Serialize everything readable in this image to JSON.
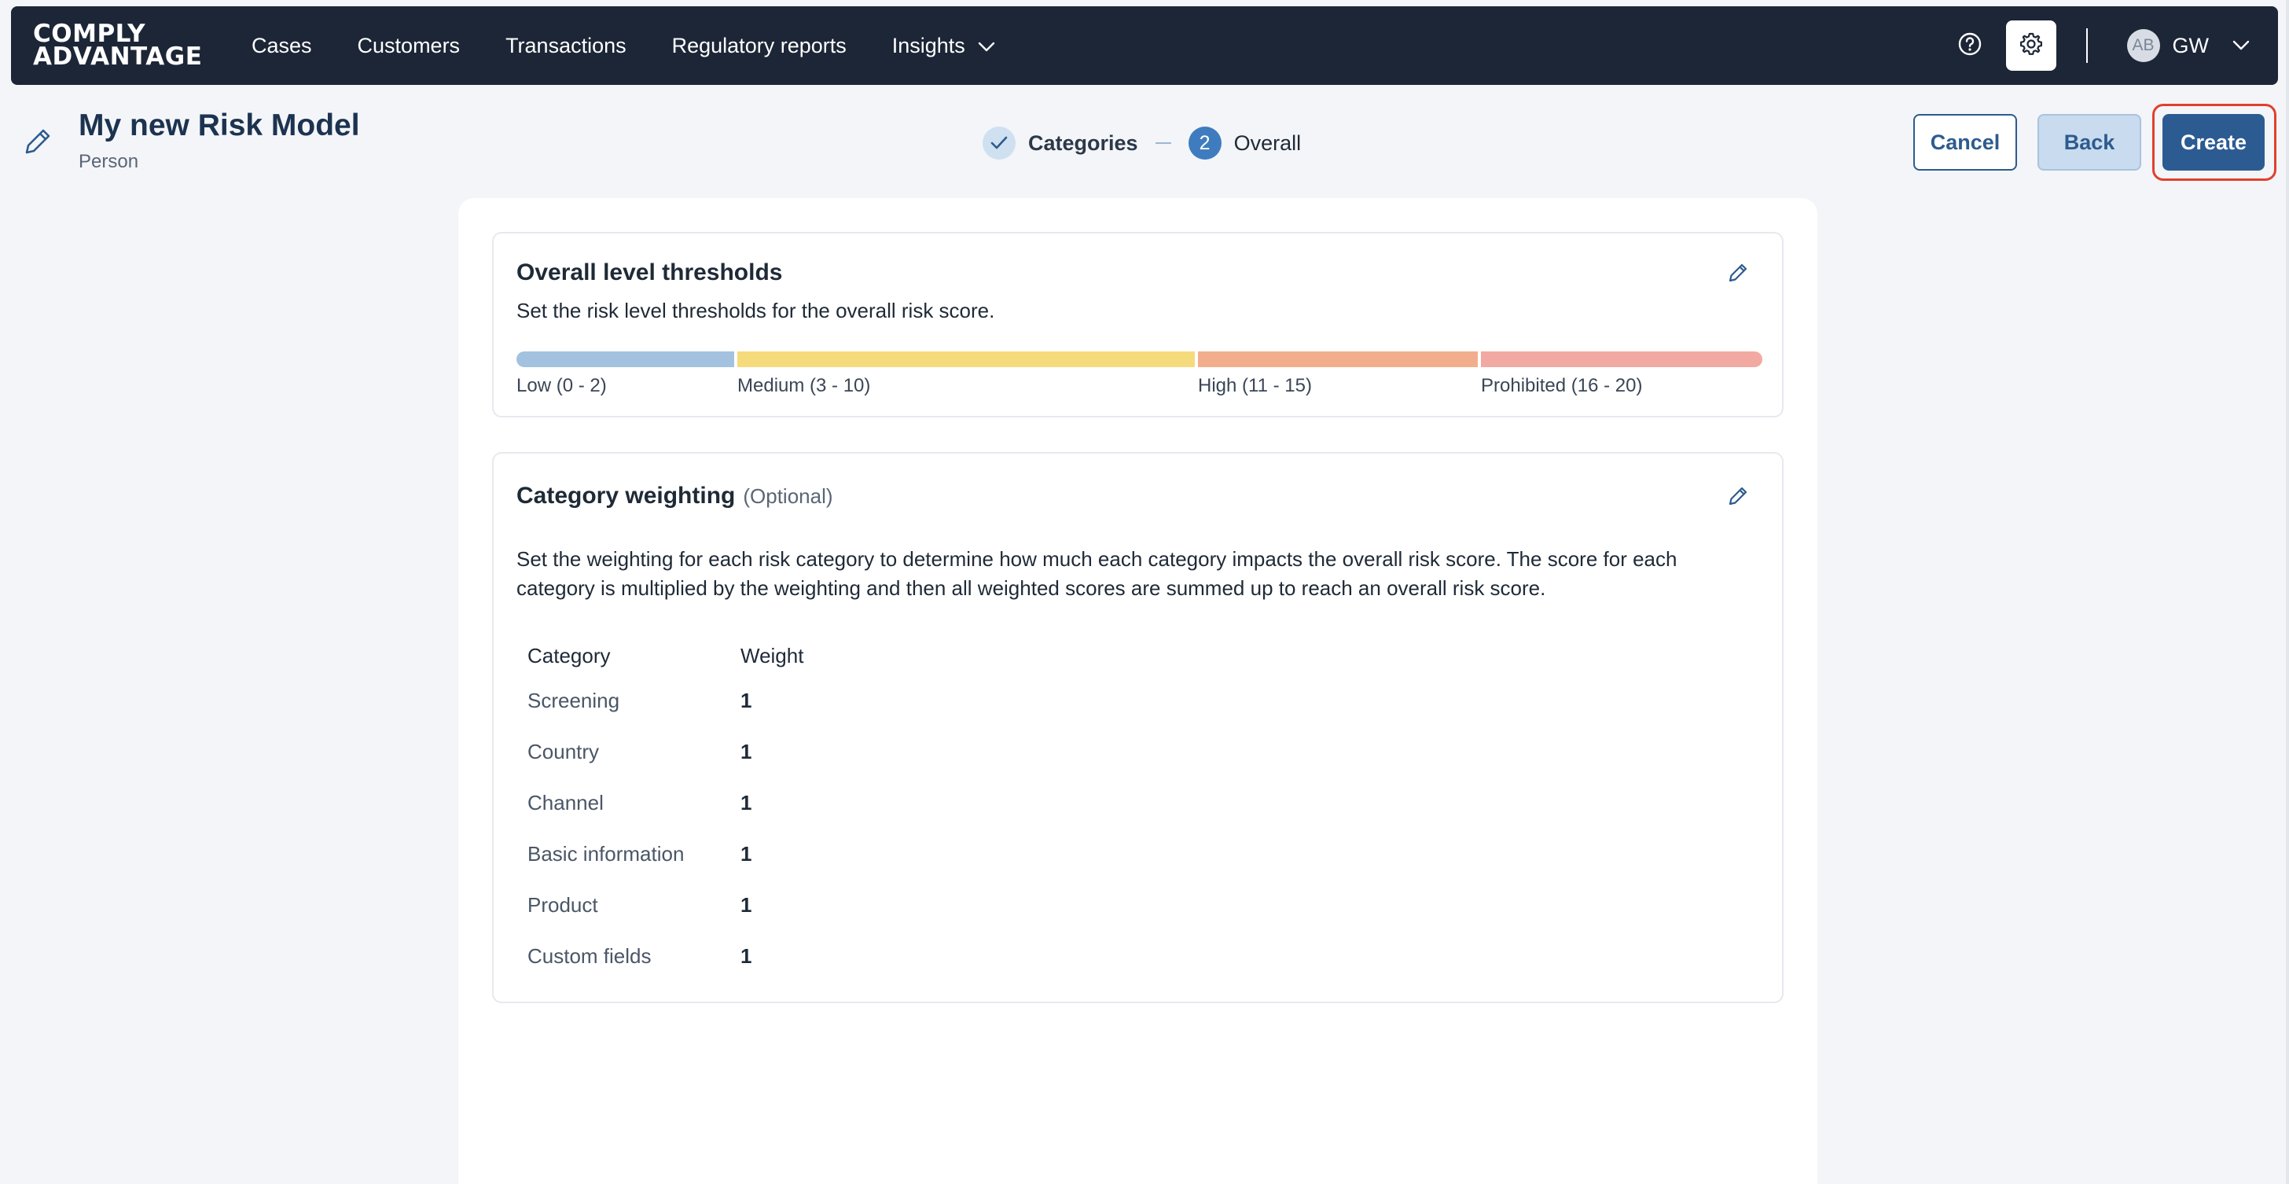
{
  "app": {
    "logo_line1": "COMPLY",
    "logo_line2": "ADVANTAGE",
    "user_avatar": "AB",
    "user_initials": "GW"
  },
  "nav": {
    "items": [
      {
        "label": "Cases"
      },
      {
        "label": "Customers"
      },
      {
        "label": "Transactions"
      },
      {
        "label": "Regulatory reports"
      },
      {
        "label": "Insights"
      }
    ]
  },
  "header": {
    "title": "My new Risk Model",
    "subtitle": "Person",
    "steps": [
      {
        "label": "Categories",
        "state": "done"
      },
      {
        "number": "2",
        "label": "Overall",
        "state": "active"
      }
    ],
    "cancel_label": "Cancel",
    "back_label": "Back",
    "create_label": "Create"
  },
  "thresholds": {
    "title": "Overall level thresholds",
    "description": "Set the risk level thresholds for the overall risk score.",
    "levels": [
      {
        "label": "Low (0 - 2)",
        "min": 0,
        "max": 2,
        "color": "#a3c2df"
      },
      {
        "label": "Medium (3 - 10)",
        "min": 3,
        "max": 10,
        "color": "#f6db7c"
      },
      {
        "label": "High (11 - 15)",
        "min": 11,
        "max": 15,
        "color": "#f2ae8c"
      },
      {
        "label": "Prohibited (16 - 20)",
        "min": 16,
        "max": 20,
        "color": "#f1a9a1"
      }
    ]
  },
  "weighting": {
    "title": "Category weighting",
    "optional": "(Optional)",
    "description_line1": "Set the weighting for each risk category to determine how much each category impacts the overall risk score. The score for each",
    "description_line2": "category is multiplied by the weighting and then all weighted scores are summed up to reach an overall risk score.",
    "col_category": "Category",
    "col_weight": "Weight",
    "rows": [
      {
        "category": "Screening",
        "weight": "1"
      },
      {
        "category": "Country",
        "weight": "1"
      },
      {
        "category": "Channel",
        "weight": "1"
      },
      {
        "category": "Basic information",
        "weight": "1"
      },
      {
        "category": "Product",
        "weight": "1"
      },
      {
        "category": "Custom fields",
        "weight": "1"
      }
    ]
  },
  "colors": {
    "nav_bg": "#1c2637",
    "primary": "#2c5b92",
    "step_active": "#3f7cbf",
    "highlight": "#e0412d"
  }
}
